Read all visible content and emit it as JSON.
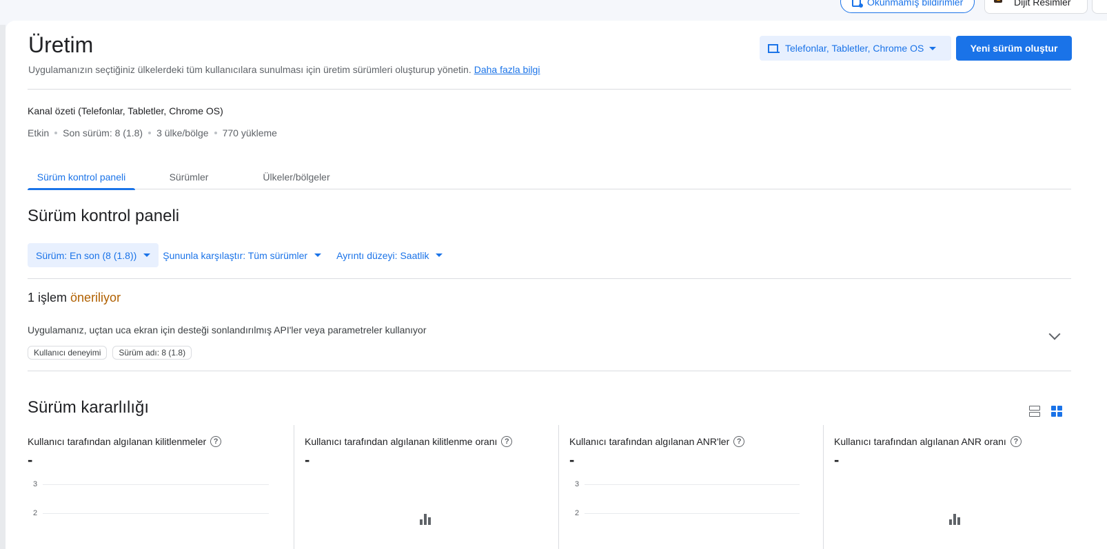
{
  "topbar": {
    "notifications_label": "Okunmamış bildirimler",
    "app_name": "Dijit Resimler"
  },
  "header": {
    "title": "Üretim",
    "subtitle": "Uygulamanızın seçtiğiniz ülkelerdeki tüm kullanıcılara sunulması için üretim sürümleri oluşturup yönetin.",
    "learn_more": "Daha fazla bilgi",
    "device_selector": "Telefonlar, Tabletler, Chrome OS",
    "create_button": "Yeni sürüm oluştur"
  },
  "summary": {
    "title": "Kanal özeti (Telefonlar, Tabletler, Chrome OS)",
    "status": "Etkin",
    "latest_release": "Son sürüm: 8 (1.8)",
    "countries": "3 ülke/bölge",
    "installs": "770 yükleme"
  },
  "tabs": [
    {
      "label": "Sürüm kontrol paneli",
      "active": true
    },
    {
      "label": "Sürümler",
      "active": false
    },
    {
      "label": "Ülkeler/bölgeler",
      "active": false
    }
  ],
  "dashboard": {
    "title": "Sürüm kontrol paneli",
    "filters": {
      "release": "Sürüm: En son (8 (1.8))",
      "compare": "Şununla karşılaştır: Tüm sürümler",
      "granularity": "Ayrıntı düzeyi: Saatlik"
    }
  },
  "recommendations": {
    "count_label": "1 işlem",
    "accent_label": "öneriliyor",
    "issue_text": "Uygulamanız, uçtan uca ekran için desteği sonlandırılmış API'ler veya parametreler kullanıyor",
    "chips": [
      "Kullanıcı deneyimi",
      "Sürüm adı: 8 (1.8)"
    ]
  },
  "stability": {
    "title": "Sürüm kararlılığı",
    "cards": [
      {
        "title": "Kullanıcı tarafından algılanan kilitlenmeler",
        "value": "-",
        "y_ticks": [
          "3",
          "2"
        ],
        "has_chart": true
      },
      {
        "title": "Kullanıcı tarafından algılanan kilitlenme oranı",
        "value": "-",
        "has_chart": false
      },
      {
        "title": "Kullanıcı tarafından algılanan ANR'ler",
        "value": "-",
        "y_ticks": [
          "3",
          "2"
        ],
        "has_chart": true
      },
      {
        "title": "Kullanıcı tarafından algılanan ANR oranı",
        "value": "-",
        "has_chart": false
      }
    ]
  },
  "colors": {
    "accent": "#1a73e8",
    "warning": "#b06000"
  }
}
